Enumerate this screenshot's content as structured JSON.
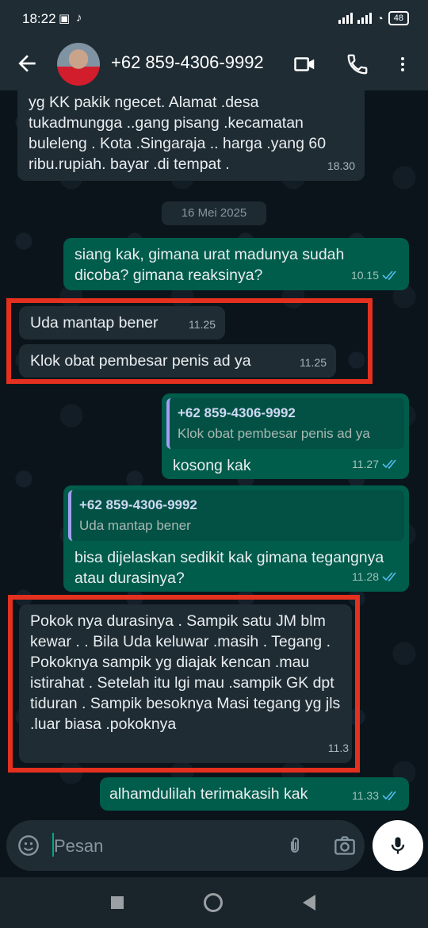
{
  "status_bar": {
    "time": "18:22",
    "battery": "48"
  },
  "header": {
    "contact": "+62 859-4306-9992"
  },
  "messages": [
    {
      "text": "yg KK pakik ngecet. Alamat .desa tukadmungga ..gang pisang .kecamatan buleleng . Kota .Singaraja .. harga .yang 60 ribu.rupiah. bayar .di tempat .",
      "time": "18.30"
    },
    {
      "text": "siang kak, gimana urat madunya sudah dicoba? gimana reaksinya?",
      "time": "10.15"
    },
    {
      "text": "Uda mantap bener",
      "time": "11.25"
    },
    {
      "text": "Klok obat pembesar penis ad ya",
      "time": "11.25"
    },
    {
      "quote_name": "+62 859-4306-9992",
      "quote_text": "Klok obat pembesar penis ad ya",
      "text": "kosong kak",
      "time": "11.27"
    },
    {
      "quote_name": "+62 859-4306-9992",
      "quote_text": "Uda mantap bener",
      "text": "bisa dijelaskan sedikit kak gimana tegangnya atau durasinya?",
      "time": "11.28"
    },
    {
      "text": "Pokok nya durasinya . Sampik satu JM blm kewar . . Bila Uda keluwar .masih . Tegang . Pokoknya sampik  yg diajak kencan .mau istirahat . Setelah itu lgi mau .sampik GK dpt tiduran .  Sampik besoknya Masi tegang yg jls .luar biasa .pokoknya",
      "time": "11.3"
    },
    {
      "text": "alhamdulilah terimakasih kak",
      "time": "11.33"
    }
  ],
  "date_separator": "16 Mei 2025",
  "input": {
    "placeholder": "Pesan"
  },
  "colors": {
    "incoming": "#1f2c34",
    "outgoing": "#005c4b",
    "highlight": "#e3301f",
    "read_tick": "#53bdeb"
  }
}
